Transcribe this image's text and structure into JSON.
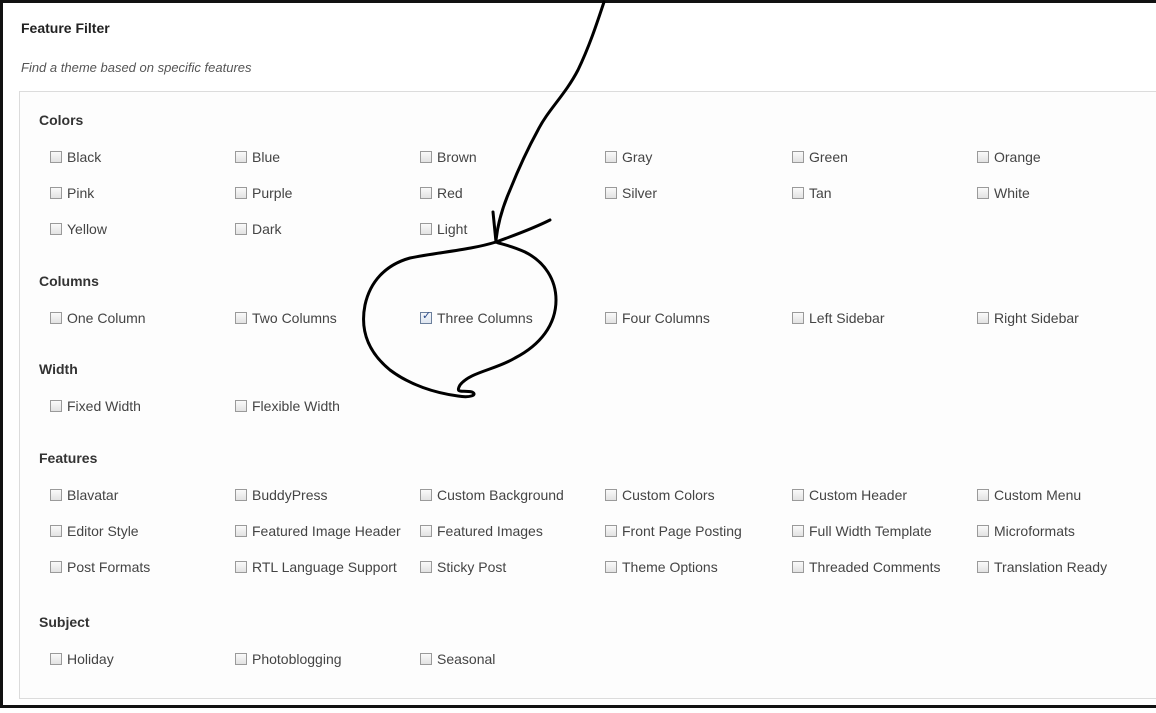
{
  "header": {
    "title": "Feature Filter",
    "subtitle": "Find a theme based on specific features"
  },
  "groups": [
    {
      "heading": "Colors",
      "options": [
        {
          "label": "Black",
          "checked": false
        },
        {
          "label": "Blue",
          "checked": false
        },
        {
          "label": "Brown",
          "checked": false
        },
        {
          "label": "Gray",
          "checked": false
        },
        {
          "label": "Green",
          "checked": false
        },
        {
          "label": "Orange",
          "checked": false
        },
        {
          "label": "Pink",
          "checked": false
        },
        {
          "label": "Purple",
          "checked": false
        },
        {
          "label": "Red",
          "checked": false
        },
        {
          "label": "Silver",
          "checked": false
        },
        {
          "label": "Tan",
          "checked": false
        },
        {
          "label": "White",
          "checked": false
        },
        {
          "label": "Yellow",
          "checked": false
        },
        {
          "label": "Dark",
          "checked": false
        },
        {
          "label": "Light",
          "checked": false
        }
      ]
    },
    {
      "heading": "Columns",
      "options": [
        {
          "label": "One Column",
          "checked": false
        },
        {
          "label": "Two Columns",
          "checked": false
        },
        {
          "label": "Three Columns",
          "checked": true
        },
        {
          "label": "Four Columns",
          "checked": false
        },
        {
          "label": "Left Sidebar",
          "checked": false
        },
        {
          "label": "Right Sidebar",
          "checked": false
        }
      ]
    },
    {
      "heading": "Width",
      "options": [
        {
          "label": "Fixed Width",
          "checked": false
        },
        {
          "label": "Flexible Width",
          "checked": false
        }
      ]
    },
    {
      "heading": "Features",
      "options": [
        {
          "label": "Blavatar",
          "checked": false
        },
        {
          "label": "BuddyPress",
          "checked": false
        },
        {
          "label": "Custom Background",
          "checked": false
        },
        {
          "label": "Custom Colors",
          "checked": false
        },
        {
          "label": "Custom Header",
          "checked": false
        },
        {
          "label": "Custom Menu",
          "checked": false
        },
        {
          "label": "Editor Style",
          "checked": false
        },
        {
          "label": "Featured Image Header",
          "checked": false
        },
        {
          "label": "Featured Images",
          "checked": false
        },
        {
          "label": "Front Page Posting",
          "checked": false
        },
        {
          "label": "Full Width Template",
          "checked": false
        },
        {
          "label": "Microformats",
          "checked": false
        },
        {
          "label": "Post Formats",
          "checked": false
        },
        {
          "label": "RTL Language Support",
          "checked": false
        },
        {
          "label": "Sticky Post",
          "checked": false
        },
        {
          "label": "Theme Options",
          "checked": false
        },
        {
          "label": "Threaded Comments",
          "checked": false
        },
        {
          "label": "Translation Ready",
          "checked": false
        }
      ]
    },
    {
      "heading": "Subject",
      "options": [
        {
          "label": "Holiday",
          "checked": false
        },
        {
          "label": "Photoblogging",
          "checked": false
        },
        {
          "label": "Seasonal",
          "checked": false
        }
      ]
    }
  ],
  "annotation": {
    "color": "#000000",
    "target": "Three Columns"
  }
}
